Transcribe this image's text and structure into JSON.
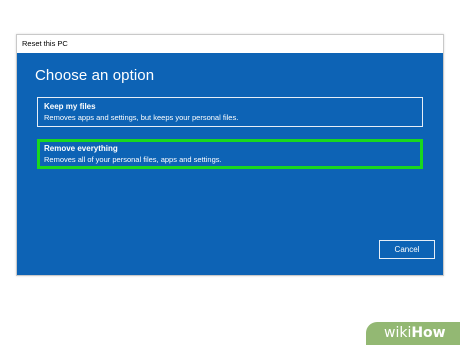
{
  "window": {
    "title": "Reset this PC"
  },
  "dialog": {
    "heading": "Choose an option",
    "options": [
      {
        "title": "Keep my files",
        "description": "Removes apps and settings, but keeps your personal files."
      },
      {
        "title": "Remove everything",
        "description": "Removes all of your personal files, apps and settings.",
        "highlighted": true
      }
    ],
    "cancel_label": "Cancel"
  },
  "watermark": {
    "wiki": "wiki",
    "how": "How"
  },
  "colors": {
    "dialog_background": "#0d63b5",
    "highlight_border": "#19d81f",
    "watermark_background": "#93b873"
  }
}
